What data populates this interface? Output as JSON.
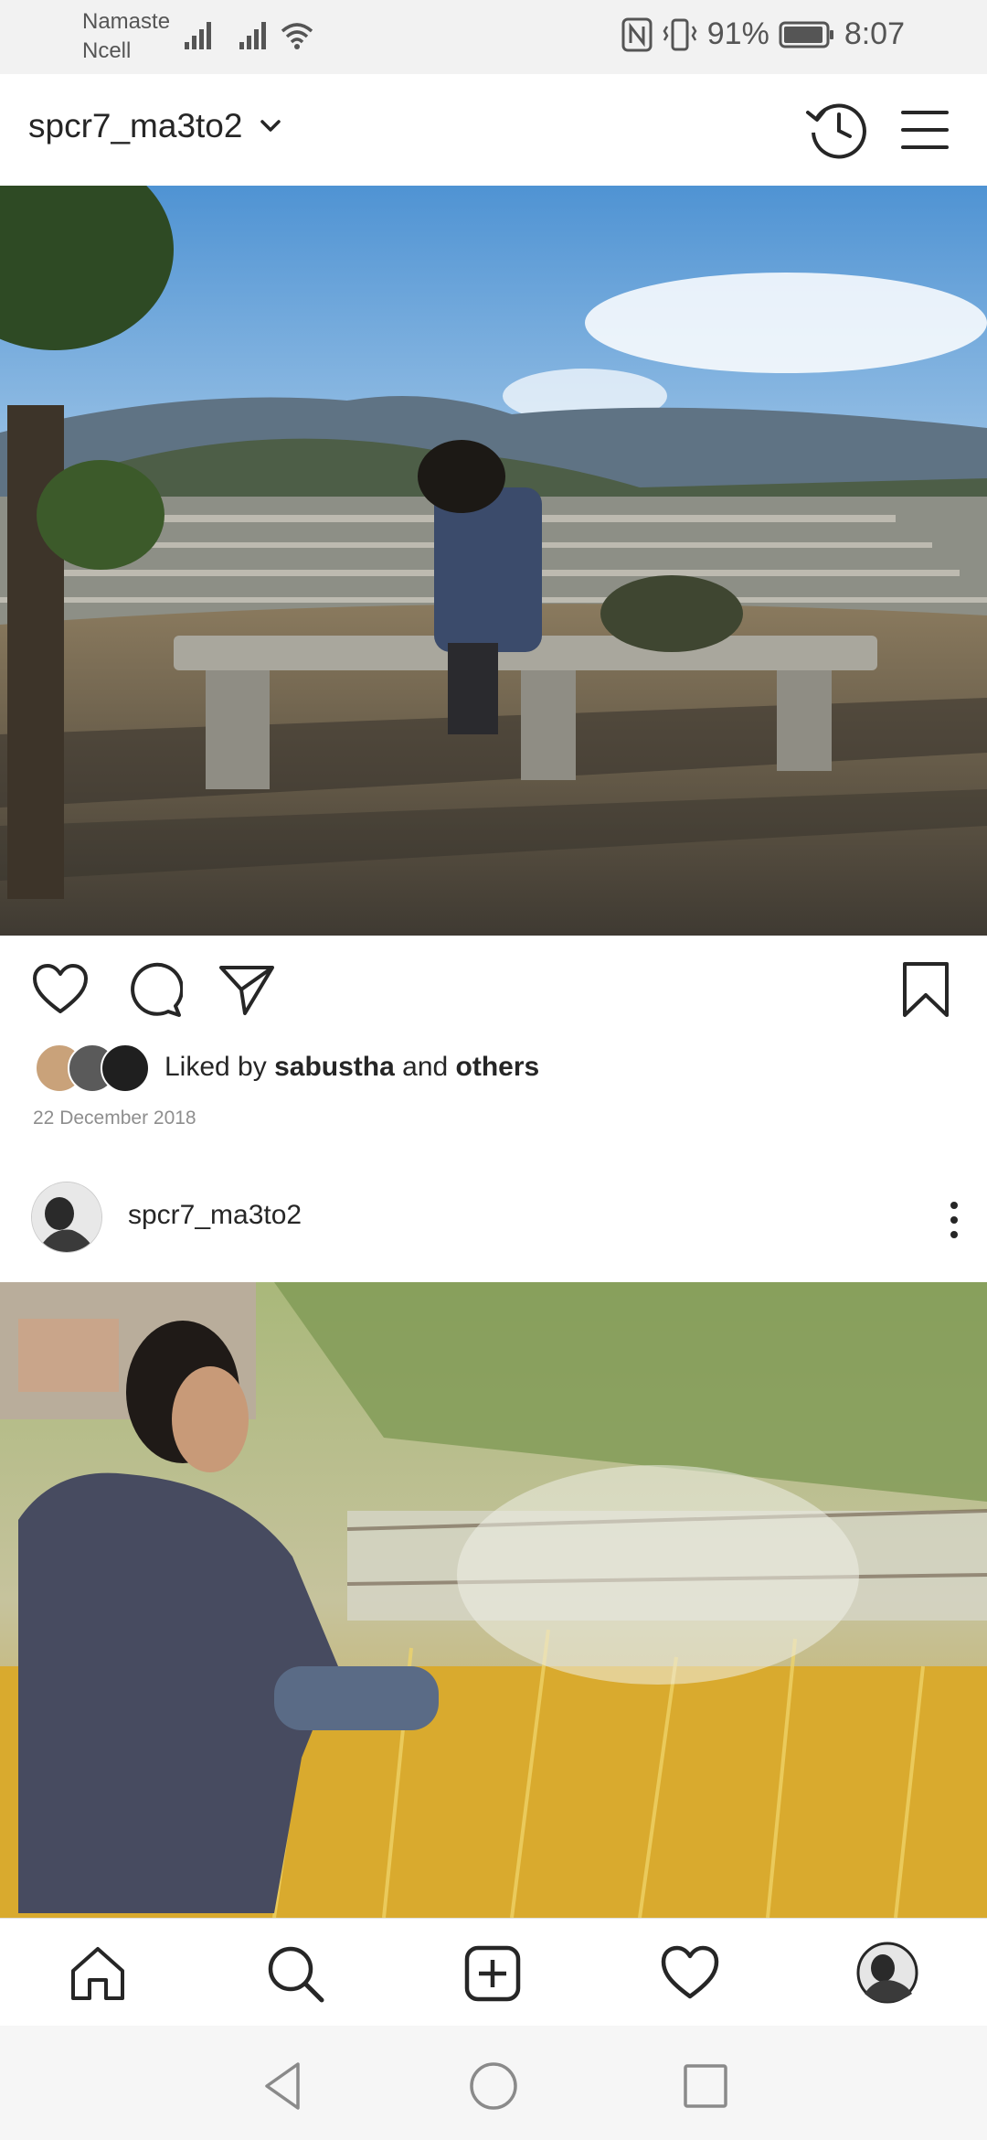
{
  "status_bar": {
    "carrier_line1": "Namaste",
    "carrier_line2": "Ncell",
    "battery": "91%",
    "time": "8:07",
    "icons": [
      "signal-icon",
      "signal-icon",
      "wifi-icon",
      "nfc-icon",
      "vibrate-icon",
      "battery-icon"
    ]
  },
  "header": {
    "account_name": "spcr7_ma3to2",
    "icons": [
      "chevron-down-icon",
      "history-icon",
      "hamburger-menu-icon"
    ]
  },
  "post1": {
    "liked_by_prefix": "Liked by ",
    "liked_by_user": "sabustha",
    "liked_by_joiner": " and ",
    "liked_by_others": "others",
    "date": "22 December 2018",
    "actions": [
      "heart-icon",
      "comment-icon",
      "share-icon",
      "bookmark-icon"
    ]
  },
  "post2": {
    "username": "spcr7_ma3to2"
  },
  "bottom_nav": {
    "items": [
      "home-icon",
      "search-icon",
      "add-post-icon",
      "activity-heart-icon",
      "profile-avatar"
    ]
  },
  "system_nav": {
    "items": [
      "back-icon",
      "home-circle-icon",
      "recents-icon"
    ]
  },
  "colors": {
    "text": "#262626",
    "muted": "#8e8e8e",
    "divider": "#dbdbdb",
    "status_bg": "#f2f2f2"
  }
}
